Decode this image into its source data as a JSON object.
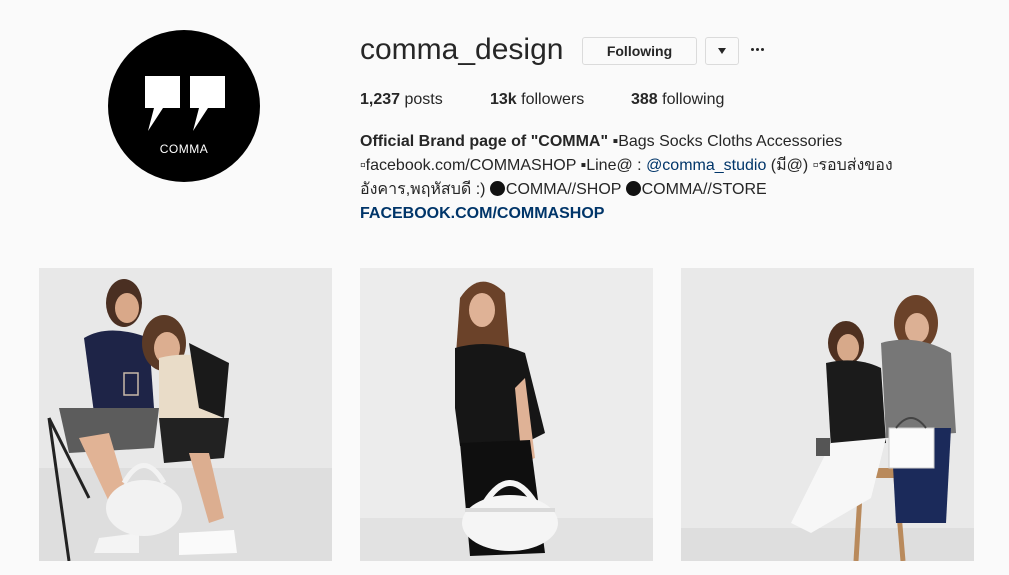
{
  "profile": {
    "username": "comma_design",
    "avatar_text": "COMMA",
    "following_label": "Following",
    "stats": {
      "posts_count": "1,237",
      "posts_label": " posts",
      "followers_count": "13k",
      "followers_label": " followers",
      "following_count": "388",
      "following_label": " following"
    },
    "bio": {
      "name": "Official Brand page of \"COMMA\"",
      "line1_rest": " ▪Bags Socks Cloths Accessories",
      "line2_a": "▫facebook.com/COMMASHOP ▪Line@ : ",
      "line2_mention": "@comma_studio",
      "line2_b": " (มี@) ▫รอบส่งของ",
      "line3_a": "อังคาร,พฤหัสบดี :) ",
      "line3_b": "COMMA//SHOP ",
      "line3_c": "COMMA//STORE",
      "website": "FACEBOOK.COM/COMMASHOP"
    }
  },
  "icons": {
    "dropdown": "chevron-down-icon",
    "more": "more-options-icon",
    "avatar": "quote-marks-logo"
  },
  "colors": {
    "background": "#fafafa",
    "text": "#262626",
    "link": "#003569",
    "border": "#dbdbdb"
  }
}
